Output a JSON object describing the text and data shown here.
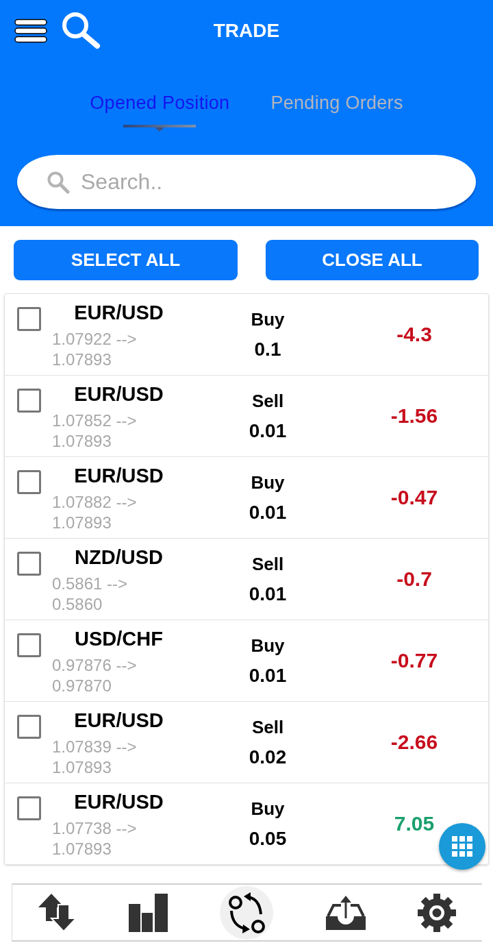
{
  "header": {
    "title": "TRADE"
  },
  "tabs": [
    {
      "label": "Opened Position",
      "selected": true
    },
    {
      "label": "Pending Orders",
      "selected": false
    }
  ],
  "search": {
    "placeholder": "Search.."
  },
  "buttons": [
    {
      "label": "SELECT ALL"
    },
    {
      "label": "CLOSE ALL"
    }
  ],
  "positions": [
    {
      "checked": false,
      "symbol": "EUR/USD",
      "prices": "1.07922 --> 1.07893",
      "side": "Buy",
      "volume": "0.1",
      "profit": "-4.3",
      "color": "#c70d1c"
    },
    {
      "checked": false,
      "symbol": "EUR/USD",
      "prices": "1.07852 --> 1.07893",
      "side": "Sell",
      "volume": "0.01",
      "profit": "-1.56",
      "color": "#c70d1c"
    },
    {
      "checked": false,
      "symbol": "EUR/USD",
      "prices": "1.07882 --> 1.07893",
      "side": "Buy",
      "volume": "0.01",
      "profit": "-0.47",
      "color": "#c70d1c"
    },
    {
      "checked": false,
      "symbol": "NZD/USD",
      "prices": "0.5861 --> 0.5860",
      "side": "Sell",
      "volume": "0.01",
      "profit": "-0.7",
      "color": "#c70d1c"
    },
    {
      "checked": false,
      "symbol": "USD/CHF",
      "prices": "0.97876 --> 0.97870",
      "side": "Buy",
      "volume": "0.01",
      "profit": "-0.77",
      "color": "#c70d1c"
    },
    {
      "checked": false,
      "symbol": "EUR/USD",
      "prices": "1.07839 --> 1.07893",
      "side": "Sell",
      "volume": "0.02",
      "profit": "-2.66",
      "color": "#c70d1c"
    },
    {
      "checked": false,
      "symbol": "EUR/USD",
      "prices": "1.07738 --> 1.07893",
      "side": "Buy",
      "volume": "0.05",
      "profit": "7.05",
      "color": "#1aa06c"
    }
  ],
  "nav": [
    {
      "kind": "arrows",
      "selected": false
    },
    {
      "kind": "bars",
      "selected": false
    },
    {
      "kind": "cycle",
      "selected": true
    },
    {
      "kind": "tray",
      "selected": false
    },
    {
      "kind": "gear",
      "selected": false
    }
  ]
}
